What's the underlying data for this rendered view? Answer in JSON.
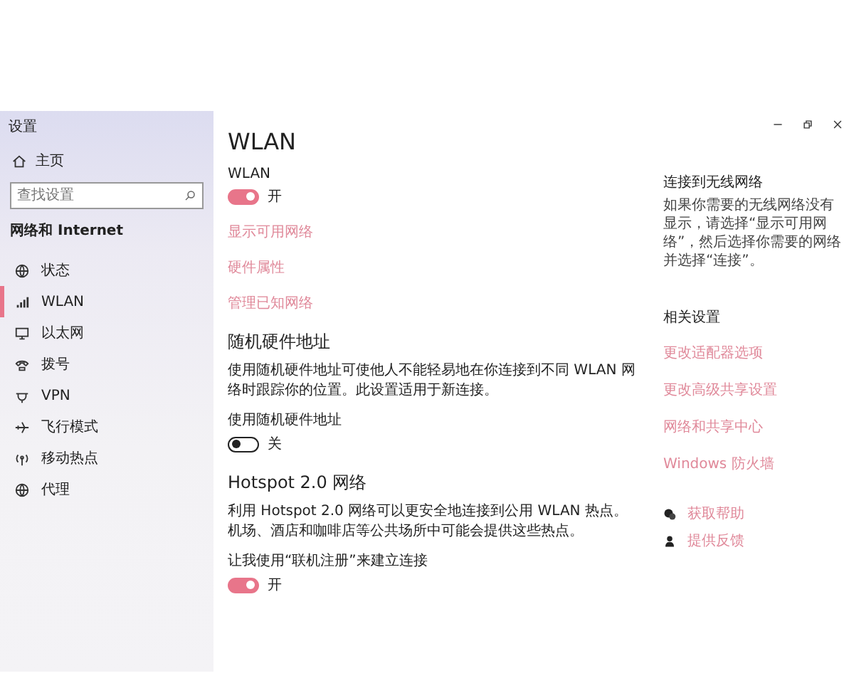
{
  "window": {
    "title": "设置"
  },
  "sidebar": {
    "home": "主页",
    "search": {
      "placeholder": "查找设置"
    },
    "section": "网络和 Internet",
    "items": [
      {
        "label": "状态",
        "kind": "status",
        "selected": false
      },
      {
        "label": "WLAN",
        "kind": "wifi",
        "selected": true
      },
      {
        "label": "以太网",
        "kind": "ethernet",
        "selected": false
      },
      {
        "label": "拨号",
        "kind": "dial",
        "selected": false
      },
      {
        "label": "VPN",
        "kind": "vpn",
        "selected": false
      },
      {
        "label": "飞行模式",
        "kind": "airplane",
        "selected": false
      },
      {
        "label": "移动热点",
        "kind": "hotspot",
        "selected": false
      },
      {
        "label": "代理",
        "kind": "proxy",
        "selected": false
      }
    ]
  },
  "main": {
    "title": "WLAN",
    "blocks": [
      {
        "kind": "label",
        "text": "WLAN"
      },
      {
        "kind": "toggle",
        "on": true,
        "text": "开"
      },
      {
        "kind": "link",
        "text": "显示可用网络"
      },
      {
        "kind": "link",
        "text": "硬件属性"
      },
      {
        "kind": "link",
        "text": "管理已知网络"
      },
      {
        "kind": "heading",
        "text": "随机硬件地址"
      },
      {
        "kind": "paragraph",
        "text": "使用随机硬件地址可使他人不能轻易地在你连接到不同 WLAN 网络时跟踪你的位置。此设置适用于新连接。"
      },
      {
        "kind": "label",
        "text": "使用随机硬件地址"
      },
      {
        "kind": "toggle",
        "on": false,
        "text": "关"
      },
      {
        "kind": "heading",
        "text": "Hotspot 2.0 网络"
      },
      {
        "kind": "paragraph",
        "text": "利用 Hotspot 2.0 网络可以更安全地连接到公用 WLAN 热点。机场、酒店和咖啡店等公共场所中可能会提供这些热点。"
      },
      {
        "kind": "label",
        "text": "让我使用“联机注册”来建立连接"
      },
      {
        "kind": "toggle",
        "on": true,
        "text": "开"
      }
    ]
  },
  "aside": {
    "heading": "连接到无线网络",
    "text": "如果你需要的无线网络没有显示，请选择“显示可用网络”，然后选择你需要的网络并选择“连接”。",
    "related_heading": "相关设置",
    "links": [
      "更改适配器选项",
      "更改高级共享设置",
      "网络和共享中心",
      "Windows 防火墙"
    ],
    "help": [
      {
        "kind": "help",
        "label": "获取帮助"
      },
      {
        "kind": "feedback",
        "label": "提供反馈"
      }
    ]
  }
}
